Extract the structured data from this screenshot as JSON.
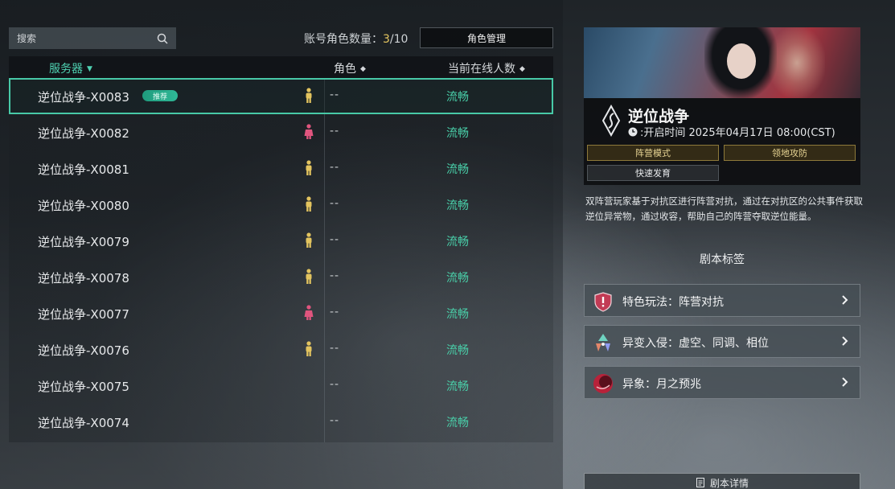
{
  "search": {
    "placeholder": "搜索",
    "icon": "search-icon"
  },
  "account": {
    "label": "账号角色数量：",
    "current": "3",
    "max": "/10"
  },
  "manage_button": "角色管理",
  "table": {
    "headers": {
      "server": "服务器",
      "role": "角色",
      "online": "当前在线人数"
    },
    "rows": [
      {
        "name": "逆位战争-X0083",
        "badge": "推荐",
        "role": "--",
        "status": "流畅",
        "figure": "gold",
        "selected": true
      },
      {
        "name": "逆位战争-X0082",
        "role": "--",
        "status": "流畅",
        "figure": "pink"
      },
      {
        "name": "逆位战争-X0081",
        "role": "--",
        "status": "流畅",
        "figure": "gold"
      },
      {
        "name": "逆位战争-X0080",
        "role": "--",
        "status": "流畅",
        "figure": "gold"
      },
      {
        "name": "逆位战争-X0079",
        "role": "--",
        "status": "流畅",
        "figure": "gold"
      },
      {
        "name": "逆位战争-X0078",
        "role": "--",
        "status": "流畅",
        "figure": "gold"
      },
      {
        "name": "逆位战争-X0077",
        "role": "--",
        "status": "流畅",
        "figure": "pink"
      },
      {
        "name": "逆位战争-X0076",
        "role": "--",
        "status": "流畅",
        "figure": "gold"
      },
      {
        "name": "逆位战争-X0075",
        "role": "--",
        "status": "流畅",
        "figure": "none"
      },
      {
        "name": "逆位战争-X0074",
        "role": "--",
        "status": "流畅",
        "figure": "none"
      }
    ]
  },
  "mode": {
    "title": "逆位战争",
    "open_time": ":开启时间 2025年04月17日 08:00(CST)",
    "tags": [
      "阵营模式",
      "领地攻防",
      "快速发育"
    ],
    "description": "双阵营玩家基于对抗区进行阵营对抗，通过在对抗区的公共事件获取逆位异常物，通过收容，帮助自己的阵营夺取逆位能量。"
  },
  "script_tags": {
    "title": "剧本标签",
    "items": [
      {
        "label": "特色玩法：阵营对抗",
        "icon": "shield-icon"
      },
      {
        "label": "异变入侵：虚空、同调、相位",
        "icon": "triad-icon"
      },
      {
        "label": "异象：月之预兆",
        "icon": "moon-omen-icon"
      }
    ]
  },
  "detail_button": "剧本详情",
  "colors": {
    "accent": "#48c9a7",
    "gold": "#e3c45f",
    "pink": "#e0557e"
  }
}
